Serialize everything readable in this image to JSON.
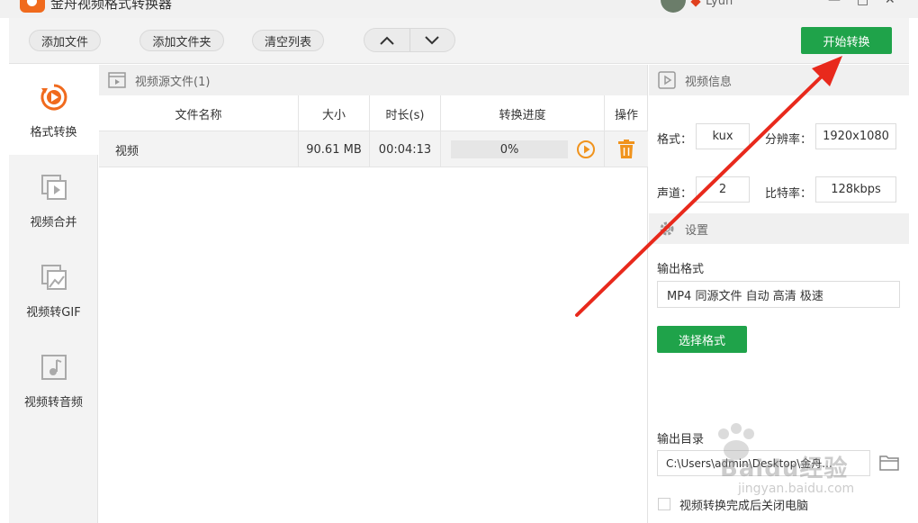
{
  "app": {
    "title": "金舟视频格式转换器"
  },
  "user": {
    "name": "Lyun"
  },
  "window_controls": {
    "minimize": "—",
    "maximize": "□",
    "close": "✕"
  },
  "toolbar": {
    "add_file": "添加文件",
    "add_folder": "添加文件夹",
    "clear_list": "清空列表",
    "start_convert": "开始转换"
  },
  "nav": [
    {
      "label": "格式转换",
      "icon": "format-convert-icon",
      "active": true
    },
    {
      "label": "视频合并",
      "icon": "video-merge-icon",
      "active": false
    },
    {
      "label": "视频转GIF",
      "icon": "video-to-gif-icon",
      "active": false
    },
    {
      "label": "视频转音频",
      "icon": "video-to-audio-icon",
      "active": false
    }
  ],
  "files": {
    "header": "视频源文件(1)",
    "columns": [
      "文件名称",
      "大小",
      "时长(s)",
      "转换进度",
      "操作"
    ],
    "rows": [
      {
        "name": "视频",
        "size": "90.61 MB",
        "duration": "00:04:13",
        "progress_text": "0%",
        "progress": 0
      }
    ]
  },
  "video_info": {
    "header": "视频信息",
    "format_label": "格式：",
    "format": "kux",
    "resolution_label": "分辨率：",
    "resolution": "1920x1080",
    "channels_label": "声道：",
    "channels": "2",
    "bitrate_label": "比特率：",
    "bitrate": "128kbps"
  },
  "settings": {
    "header": "设置",
    "output_format_label": "输出格式",
    "output_format": "MP4 同源文件 自动 高清 极速",
    "choose_format": "选择格式",
    "output_dir_label": "输出目录",
    "output_dir": "C:\\Users\\admin\\Desktop\\金舟...",
    "shutdown_label": "视频转换完成后关闭电脑",
    "shutdown_checked": false
  },
  "watermark": {
    "text": "Baidu经验",
    "url": "jingyan.baidu.com"
  },
  "colors": {
    "accent_green": "#1fa34a",
    "brand_orange": "#f06a1d",
    "annotation_red": "#e8291c"
  }
}
